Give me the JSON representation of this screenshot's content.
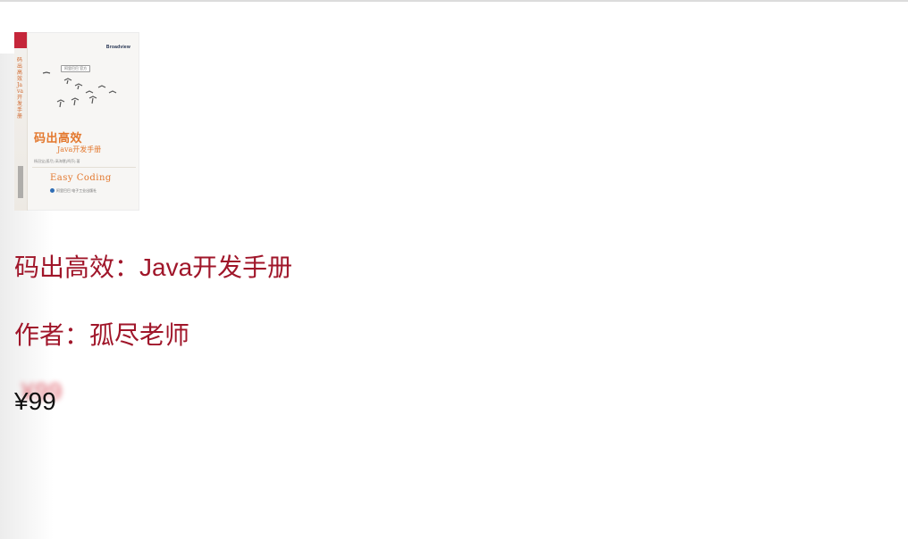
{
  "product": {
    "cover": {
      "logo": "Broadview",
      "badge": "阿里巴巴 官方",
      "title": "码出高效",
      "subtitle": "Java开发手册",
      "spine_text": "码出高效 Java开发手册",
      "authors": "杨冠宝(孤尽) 高海慧(鸣莎) 著",
      "easy_coding": "Easy Coding",
      "publisher": "阿里巴巴 电子工业出版社"
    },
    "title": "码出高效：Java开发手册",
    "author": "作者：孤尽老师",
    "price": "¥99",
    "price_shadow": "¥99"
  },
  "colors": {
    "accent": "#a0162a",
    "price": "#111111",
    "cover_orange": "#e3782e",
    "spine_red": "#c5263a"
  }
}
